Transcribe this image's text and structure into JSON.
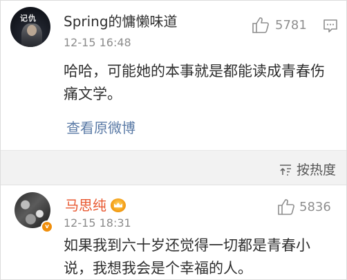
{
  "comments": [
    {
      "avatar_text": "记仇",
      "username": "Spring的慵懒味道",
      "timestamp": "12-15 16:48",
      "likes": "5781",
      "content": "哈哈，可能她的本事就是都能读成青春伤痛文学。",
      "link": "查看原微博"
    },
    {
      "username": "马思纯",
      "timestamp": "12-15 18:31",
      "likes": "5836",
      "content": "如果我到六十岁还觉得一切都是青春小说，我想我会是个幸福的人。"
    }
  ],
  "sort": {
    "label": "按热度"
  },
  "icons": {
    "like": "thumbs-up-icon",
    "comment": "comment-icon",
    "sort": "sort-icon",
    "verified": "verified-badge-icon",
    "vip": "vip-crown-icon"
  },
  "colors": {
    "link": "#5a7aa6",
    "vip_username": "#e8572f",
    "meta_gray": "#8c8c8c",
    "separator_bg": "#f2f2f2"
  }
}
